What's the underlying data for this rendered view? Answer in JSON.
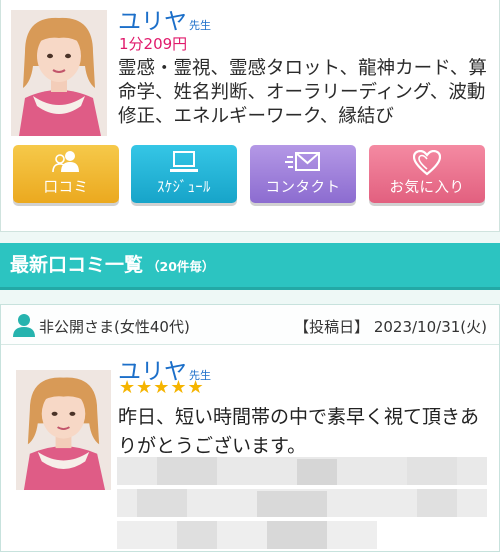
{
  "reader": {
    "name": "ユリヤ",
    "honorific": "先生",
    "price": "1分209円",
    "genres": "霊感・霊視、霊感タロット、龍神カード、算命学、姓名判断、オーラリーディング、波動修正、エネルギーワーク、縁結び"
  },
  "buttons": {
    "review": {
      "label": "口コミ",
      "icon": "people-icon",
      "color": "#eba91f"
    },
    "schedule": {
      "label": "ｽｹｼﾞｭｰﾙ",
      "icon": "monitor-icon",
      "color": "#17a4c9"
    },
    "contact": {
      "label": "コンタクト",
      "icon": "mail-icon",
      "color": "#8c6cd0"
    },
    "favorite": {
      "label": "お気に入り",
      "icon": "heart-icon",
      "color": "#e2607f"
    }
  },
  "reviews_section": {
    "title": "最新口コミ一覧",
    "subtitle": "（20件毎）",
    "accent": "#2cc4c1"
  },
  "review": {
    "reviewer": "非公開さま(女性40代)",
    "post_date": "【投稿日】 2023/10/31(火)",
    "reader_name": "ユリヤ",
    "reader_honorific": "先生",
    "rating": 5,
    "stars": "★★★★★",
    "text": "昨日、短い時間帯の中で素早く視て頂きありがとうございます。"
  }
}
